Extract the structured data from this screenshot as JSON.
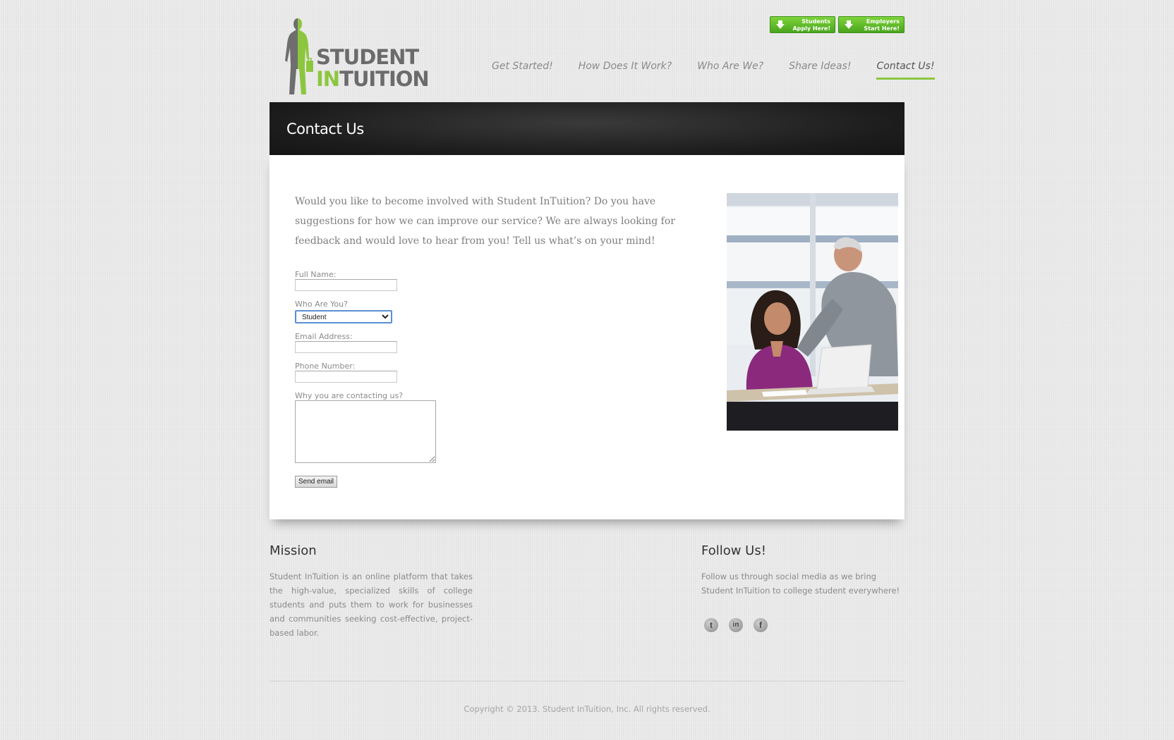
{
  "logo": {
    "line1": "STUDENT",
    "line2_green": "IN",
    "line2_dark": "TUITION"
  },
  "cta": {
    "students_line1": "Students",
    "students_line2": "Apply Here!",
    "employers_line1": "Employers",
    "employers_line2": "Start Here!"
  },
  "nav": {
    "items": [
      {
        "label": "Get Started!"
      },
      {
        "label": "How Does It Work?"
      },
      {
        "label": "Who Are We?"
      },
      {
        "label": "Share Ideas!"
      },
      {
        "label": "Contact Us!",
        "active": true
      }
    ]
  },
  "banner": {
    "title": "Contact Us"
  },
  "intro": "Would you like to become involved with Student InTuition? Do you have suggestions for how we can improve our service? We are always looking for feedback and would love to hear from you! Tell us what’s on your mind!",
  "form": {
    "full_name_label": "Full Name:",
    "full_name_value": "",
    "who_label": "Who Are You?",
    "who_selected": "Student",
    "email_label": "Email Address:",
    "email_value": "",
    "phone_label": "Phone Number:",
    "phone_value": "",
    "reason_label": "Why you are contacting us?",
    "reason_value": "",
    "send_label": "Send email"
  },
  "footer": {
    "mission_title": "Mission",
    "mission_text": "Student InTuition is an online platform that takes the high-value, specialized skills of college students and puts them to work for businesses and communities seeking cost-effective, project-based labor.",
    "follow_title": "Follow Us!",
    "follow_text": "Follow us through social media as we bring Student InTuition to college student everywhere!",
    "social_twitter": "t",
    "social_linkedin": "in",
    "social_facebook": "f",
    "copyright": "Copyright © 2013. Student InTuition, Inc. All rights reserved."
  },
  "colors": {
    "accent": "#8cc63f",
    "banner": "#1c1c1c",
    "cta": "#5cb82a"
  },
  "icons": [
    "logo-figure-icon",
    "download-arrow-icon",
    "twitter-icon",
    "linkedin-icon",
    "facebook-icon"
  ]
}
